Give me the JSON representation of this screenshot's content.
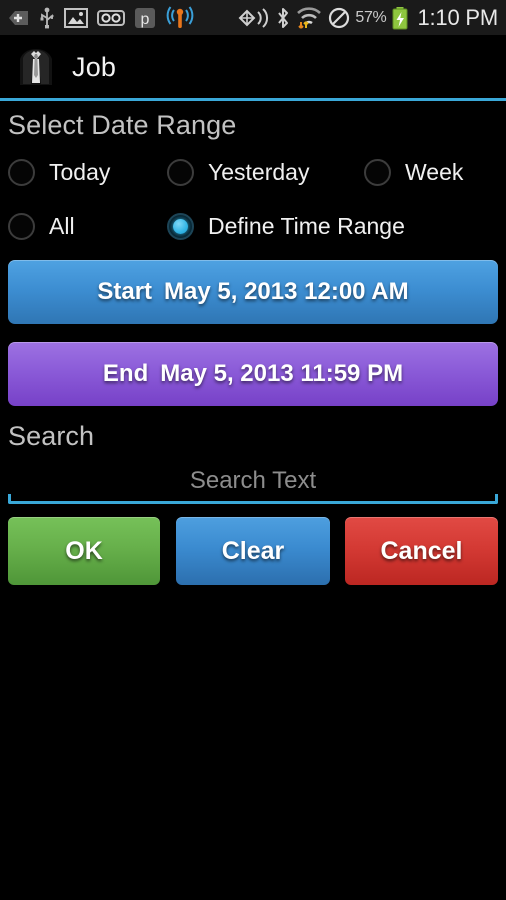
{
  "status_bar": {
    "left_icons": [
      {
        "name": "download-badge-icon",
        "glyph": "+"
      },
      {
        "name": "usb-icon",
        "glyph": "USB"
      },
      {
        "name": "image-icon",
        "glyph": "IMG"
      },
      {
        "name": "voicemail-icon",
        "glyph": "OO"
      },
      {
        "name": "p-app-icon",
        "glyph": "p"
      },
      {
        "name": "wireless-signal-icon",
        "glyph": "((*))"
      }
    ],
    "right_icons": [
      {
        "name": "nfc-beam-icon",
        "glyph": "((+))"
      },
      {
        "name": "bluetooth-icon",
        "glyph": "B"
      },
      {
        "name": "wifi-data-icon",
        "glyph": "wifi"
      },
      {
        "name": "do-not-disturb-icon",
        "glyph": "no"
      },
      {
        "name": "battery-charging-icon",
        "glyph": "bat"
      }
    ],
    "battery_percent": "57%",
    "clock": "1:10 PM"
  },
  "title_bar": {
    "app_icon": "suit-tie-icon",
    "title": "Job",
    "accent_color": "#3aa8d8"
  },
  "date_range": {
    "section_label": "Select Date Range",
    "options": [
      {
        "label": "Today",
        "selected": false
      },
      {
        "label": "Yesterday",
        "selected": false
      },
      {
        "label": "Week",
        "selected": false
      },
      {
        "label": "All",
        "selected": false
      },
      {
        "label": "Define Time Range",
        "selected": true
      }
    ],
    "start_button": {
      "lead": "Start",
      "value": "May 5, 2013 12:00 AM",
      "color": "#3d8ed2"
    },
    "end_button": {
      "lead": "End",
      "value": "May 5, 2013 11:59 PM",
      "color": "#8b5bd8"
    }
  },
  "search": {
    "section_label": "Search",
    "placeholder": "Search Text",
    "value": "",
    "underline_color": "#3aa8d8"
  },
  "actions": {
    "ok_label": "OK",
    "clear_label": "Clear",
    "cancel_label": "Cancel",
    "ok_color": "#67b04b",
    "clear_color": "#3b8bd0",
    "cancel_color": "#d43a34"
  }
}
